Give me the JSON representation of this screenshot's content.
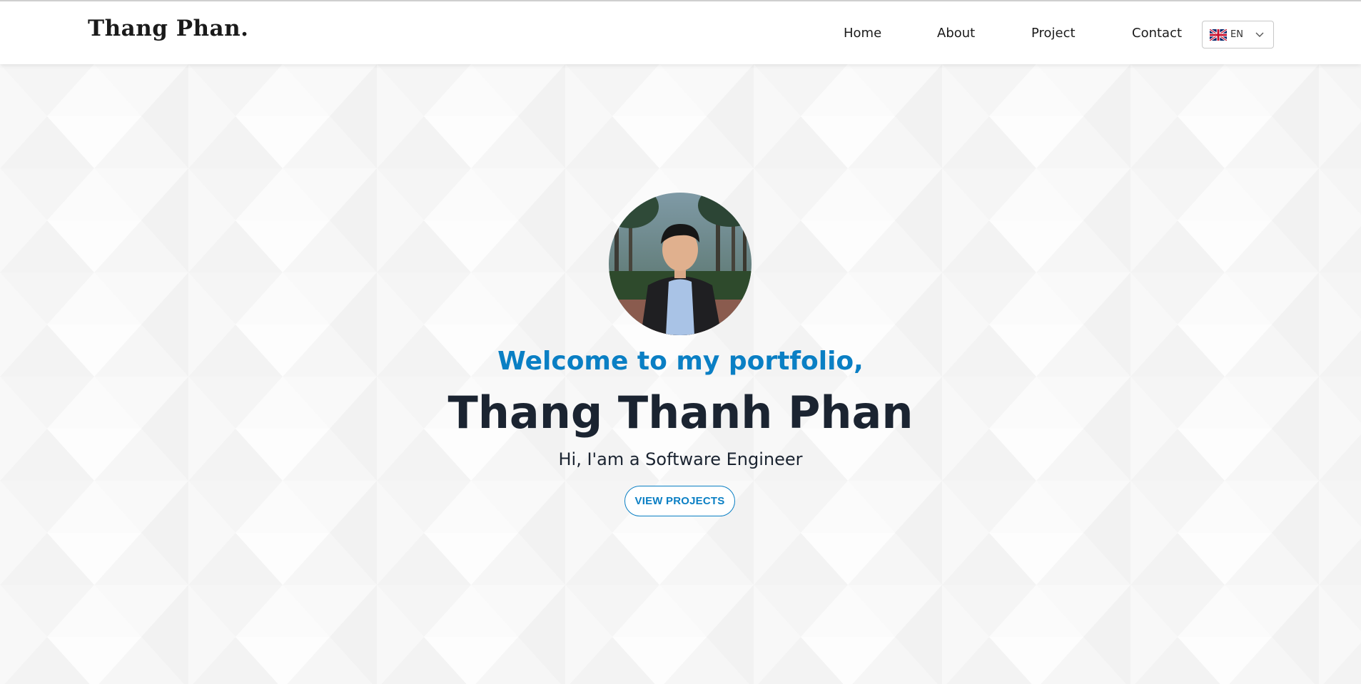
{
  "header": {
    "logo": "Thang Phan.",
    "nav": [
      {
        "label": "Home"
      },
      {
        "label": "About"
      },
      {
        "label": "Project"
      },
      {
        "label": "Contact"
      }
    ],
    "language": {
      "code": "EN",
      "flag": "uk-flag-icon"
    }
  },
  "hero": {
    "welcome": "Welcome to my portfolio,",
    "name": "Thang Thanh Phan",
    "tagline": "Hi, I'am a Software Engineer",
    "cta_label": "VIEW PROJECTS"
  },
  "colors": {
    "accent": "#0a7fc4",
    "heading": "#1b2431",
    "background": "#ffffff"
  }
}
